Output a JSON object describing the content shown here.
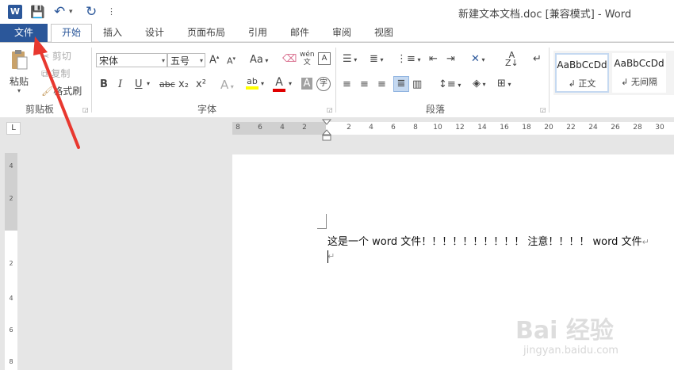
{
  "window": {
    "title": "新建文本文档.doc [兼容模式] - Word",
    "logo": "W"
  },
  "qat": {
    "save": "💾",
    "undo": "↶",
    "undo_drop": "▾",
    "redo": "↻",
    "more": "⋮"
  },
  "tabs": {
    "file": "文件",
    "home": "开始",
    "insert": "插入",
    "design": "设计",
    "layout": "页面布局",
    "references": "引用",
    "mailings": "邮件",
    "review": "审阅",
    "view": "视图"
  },
  "clipboard": {
    "paste": "粘贴",
    "cut": "剪切",
    "copy": "复制",
    "format_painter": "格式刷",
    "group_label": "剪贴板"
  },
  "font": {
    "name": "宋体",
    "size": "五号",
    "group_label": "字体",
    "grow": "A",
    "shrink": "A",
    "case": "Aa",
    "bold": "B",
    "italic": "I",
    "underline": "U",
    "strike": "abc",
    "sub": "x₂",
    "sup": "x²",
    "effects": "A",
    "highlight": "ab",
    "color": "A",
    "shade": "A",
    "phonetic": "wén",
    "enclose": "字"
  },
  "paragraph": {
    "group_label": "段落"
  },
  "styles": {
    "items": [
      {
        "sample": "AaBbCcDd",
        "name": "↲ 正文"
      },
      {
        "sample": "AaBbCcDd",
        "name": "↲ 无间隔"
      }
    ]
  },
  "ruler": {
    "selector": "L",
    "left_numbers": [
      "8",
      "6",
      "4",
      "2"
    ],
    "right_numbers": [
      "2",
      "4",
      "6",
      "8",
      "10",
      "12",
      "14",
      "16",
      "18",
      "20",
      "22",
      "24",
      "26",
      "28",
      "30"
    ],
    "vertical_numbers": [
      "4",
      "2",
      "2",
      "4",
      "6",
      "8"
    ]
  },
  "document": {
    "line1": "这是一个 word 文件！！！！！！！！！！ 注意！！！！  word 文件",
    "pilcrow": "↵"
  },
  "watermark": {
    "main": "Bai 经验",
    "sub": "jingyan.baidu.com"
  },
  "colors": {
    "accent": "#2b579a",
    "highlight": "#ffff00",
    "font_color": "#e00000",
    "arrow": "#e8382f"
  }
}
